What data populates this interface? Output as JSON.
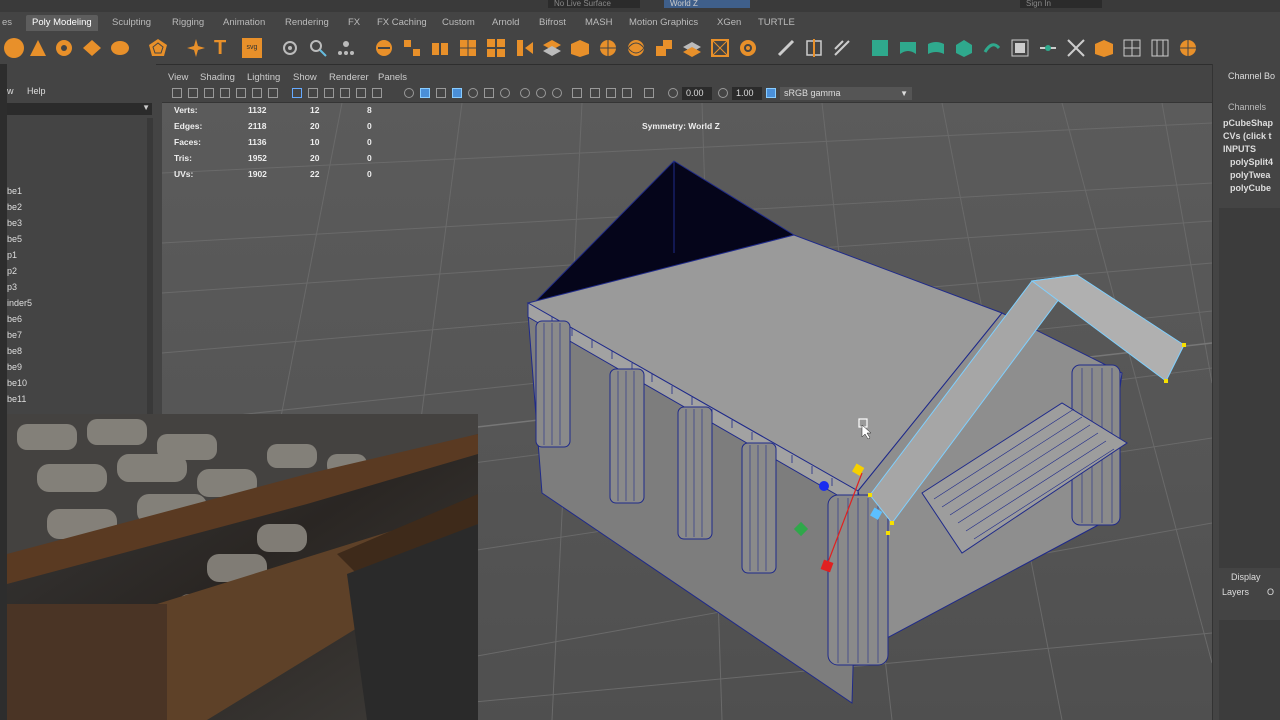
{
  "topbar": {
    "live_surface": "No Live Surface",
    "world_field": "World Z",
    "sign_in": "Sign In"
  },
  "tabs": [
    "es",
    "Poly Modeling",
    "Sculpting",
    "Rigging",
    "Animation",
    "Rendering",
    "FX",
    "FX Caching",
    "Custom",
    "Arnold",
    "Bifrost",
    "MASH",
    "Motion Graphics",
    "XGen",
    "TURTLE"
  ],
  "active_tab": "Poly Modeling",
  "outliner": {
    "menu": [
      "w",
      "Help"
    ],
    "items": [
      "be1",
      "be2",
      "be3",
      "be5",
      "p1",
      "p2",
      "p3",
      "inder5",
      "be6",
      "be7",
      "be8",
      "be9",
      "be10",
      "be11"
    ]
  },
  "viewport": {
    "menu": [
      "View",
      "Shading",
      "Lighting",
      "Show",
      "Renderer",
      "Panels"
    ],
    "exposure": "0.00",
    "gamma": "1.00",
    "color_space": "sRGB gamma",
    "symmetry": "Symmetry: World Z",
    "hud": [
      {
        "label": "Verts:",
        "total": "1132",
        "sel": "12",
        "comp": "8"
      },
      {
        "label": "Edges:",
        "total": "2118",
        "sel": "20",
        "comp": "0"
      },
      {
        "label": "Faces:",
        "total": "1136",
        "sel": "10",
        "comp": "0"
      },
      {
        "label": "Tris:",
        "total": "1952",
        "sel": "20",
        "comp": "0"
      },
      {
        "label": "UVs:",
        "total": "1902",
        "sel": "22",
        "comp": "0"
      }
    ]
  },
  "channel_box": {
    "title": "Channel Bo",
    "channels": "Channels",
    "shape": "pCubeShap",
    "cvs": "CVs (click t",
    "inputs": "INPUTS",
    "nodes": [
      "polySplit4",
      "polyTwea",
      "polyCube"
    ],
    "display": "Display",
    "layers": "Layers",
    "opt": "O"
  },
  "colors": {
    "accent": "#e8902a",
    "wire": "#1f2a8a",
    "highlight": "#7fd0ff"
  }
}
